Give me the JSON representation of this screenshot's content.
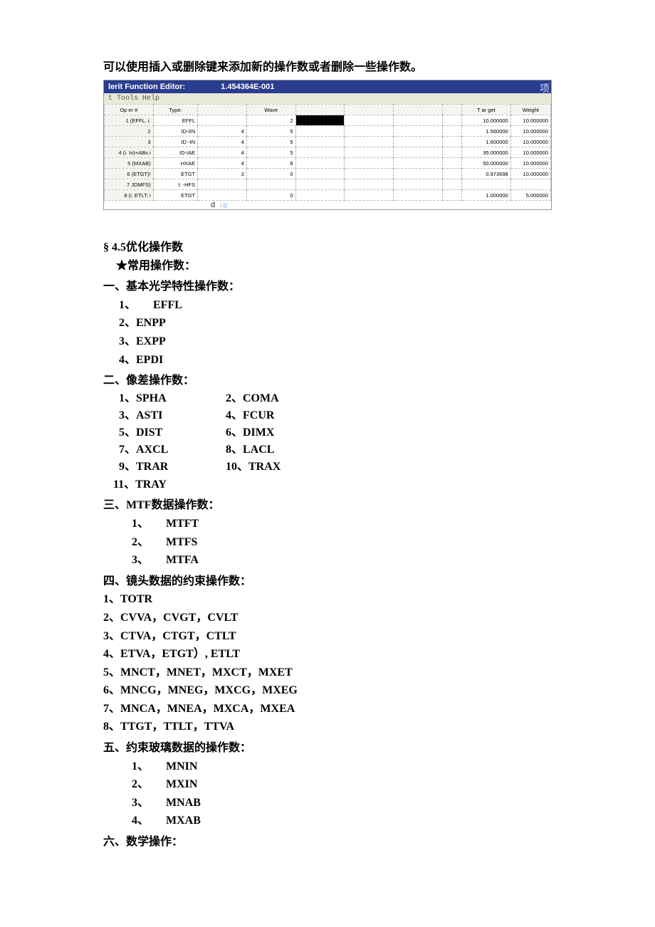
{
  "intro": "可以使用插入或删除键来添加新的操作数或者删除一些操作数。",
  "editor": {
    "title1": "lerit Function Editor:",
    "title2": "1.454364E-001",
    "corner": "项",
    "menu": "t Tools Help",
    "headers": {
      "op": "Op er #",
      "type": "Type:",
      "a": "",
      "wave": "Wave",
      "b1": "",
      "b2": "",
      "b3": "",
      "b4": "",
      "target": "T ar get",
      "weight": "Weight"
    },
    "rows": [
      {
        "op": "1 (EFFL. i.",
        "type": "EFFL",
        "a": "",
        "wave": "2",
        "black": true,
        "target": "10.000000",
        "weight": "10.000000"
      },
      {
        "op": "2",
        "type": "ID-IIN",
        "a": "4",
        "wave": "5",
        "black": false,
        "target": "1.560000",
        "weight": "10.000000"
      },
      {
        "op": "3",
        "type": "ID -IN",
        "a": "4",
        "wave": "5",
        "black": false,
        "target": "1.600000",
        "weight": "10.000000"
      },
      {
        "op": "4 (i. Io)+ABs i",
        "type": "ID-IAE",
        "a": "4",
        "wave": "5",
        "black": false,
        "target": "35.000000",
        "weight": "10.000000"
      },
      {
        "op": "5 (MXAB)",
        "type": "HXAE",
        "a": "4",
        "wave": "8",
        "black": false,
        "target": "50.000000",
        "weight": "10.000000"
      },
      {
        "op": "6 (ETGT)!",
        "type": "ETGT",
        "a": "3",
        "wave": "0",
        "black": false,
        "target": "0.973698",
        "weight": "10.000000"
      },
      {
        "op": "7 JDMFS)",
        "type": "I: -HFS",
        "a": "",
        "wave": "",
        "black": false,
        "target": "",
        "weight": ""
      },
      {
        "op": "8 (i. ETLT; i",
        "type": "ETGT",
        "a": "",
        "wave": "0",
        "black": false,
        "target": "1.000000",
        "weight": "5.000000"
      }
    ],
    "footer_d": "d",
    "footer_ij": "i,ij)"
  },
  "sections": {
    "s45": "§  4.5优化操作数",
    "common": "★常用操作数：",
    "h1": "一、基本光学特性操作数：",
    "basic": [
      "1、　　EFFL",
      "2、ENPP",
      "3、EXPP",
      "4、EPDI"
    ],
    "h2": "二、像差操作数：",
    "aberr": [
      [
        "1、SPHA",
        "2、COMA"
      ],
      [
        "3、ASTI",
        "4、FCUR"
      ],
      [
        "5、DIST",
        "6、DIMX"
      ],
      [
        "7、AXCL",
        "  8、LACL"
      ],
      [
        "9、TRAR",
        "10、TRAX"
      ]
    ],
    "aberr_last": "11、TRAY",
    "h3": "三、MTF数据操作数：",
    "mtf": [
      "1、　　MTFT",
      "2、　　MTFS",
      "3、　　MTFA"
    ],
    "h4": "四、镜头数据的约束操作数：",
    "lens": [
      "1、TOTR",
      "2、CVVA，CVGT，CVLT",
      "3、CTVA，CTGT，CTLT",
      "4、ETVA，ETGT）, ETLT",
      "5、MNCT，MNET，MXCT，MXET",
      "6、MNCG，MNEG，MXCG，MXEG",
      "7、MNCA，MNEA，MXCA，MXEA",
      "8、TTGT，TTLT，TTVA"
    ],
    "h5": "五、约束玻璃数据的操作数：",
    "glass": [
      "1、　　MNIN",
      "2、　　MXIN",
      "3、　　MNAB",
      "4、　　MXAB"
    ],
    "h6": "六、数学操作："
  }
}
